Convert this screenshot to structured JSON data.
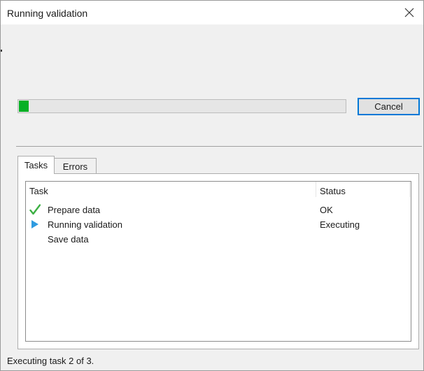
{
  "window": {
    "title": "Running validation"
  },
  "progress": {
    "fraction": 0.03,
    "fill_color": "#06b025"
  },
  "buttons": {
    "cancel_label": "Cancel"
  },
  "tabs": [
    {
      "label": "Tasks",
      "active": true
    },
    {
      "label": "Errors",
      "active": false
    }
  ],
  "task_list": {
    "columns": [
      "Task",
      "Status"
    ],
    "rows": [
      {
        "icon": "checkmark-icon",
        "name": "Prepare data",
        "status": "OK"
      },
      {
        "icon": "play-arrow-icon",
        "name": "Running validation",
        "status": "Executing"
      },
      {
        "icon": "",
        "name": "Save data",
        "status": ""
      }
    ]
  },
  "status_bar": {
    "text": "Executing task 2 of 3."
  },
  "colors": {
    "accent": "#0078d7",
    "check": "#3cb043",
    "arrow": "#2f9be0"
  }
}
